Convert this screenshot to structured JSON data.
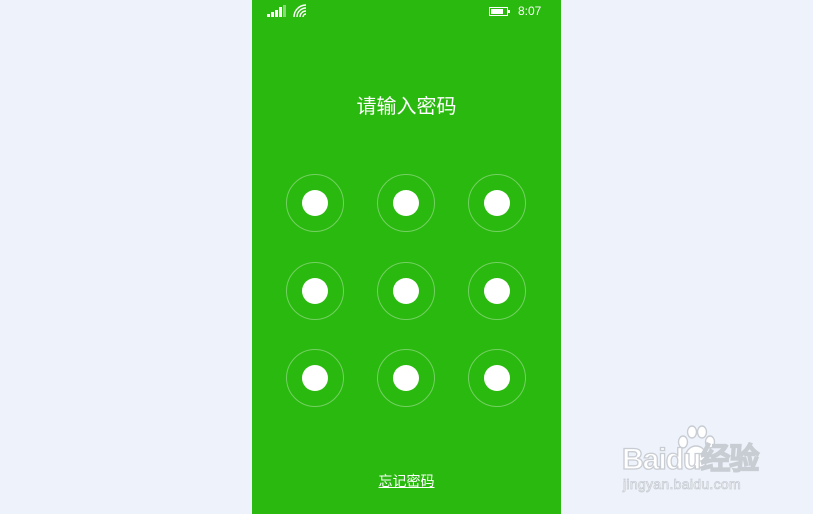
{
  "status_bar": {
    "time": "8:07",
    "signal_icon": "signal-bars-icon",
    "wifi_icon": "wifi-icon",
    "battery_icon": "battery-icon"
  },
  "screen": {
    "title": "请输入密码",
    "pattern_nodes": [
      "1",
      "2",
      "3",
      "4",
      "5",
      "6",
      "7",
      "8",
      "9"
    ],
    "forgot_link": "忘记密码"
  },
  "colors": {
    "background": "#eef2fa",
    "phone_background": "#2ab90f",
    "foreground": "#ffffff"
  },
  "watermark": {
    "logo_text": "Baidu经验",
    "url": "jingyan.baidu.com"
  }
}
